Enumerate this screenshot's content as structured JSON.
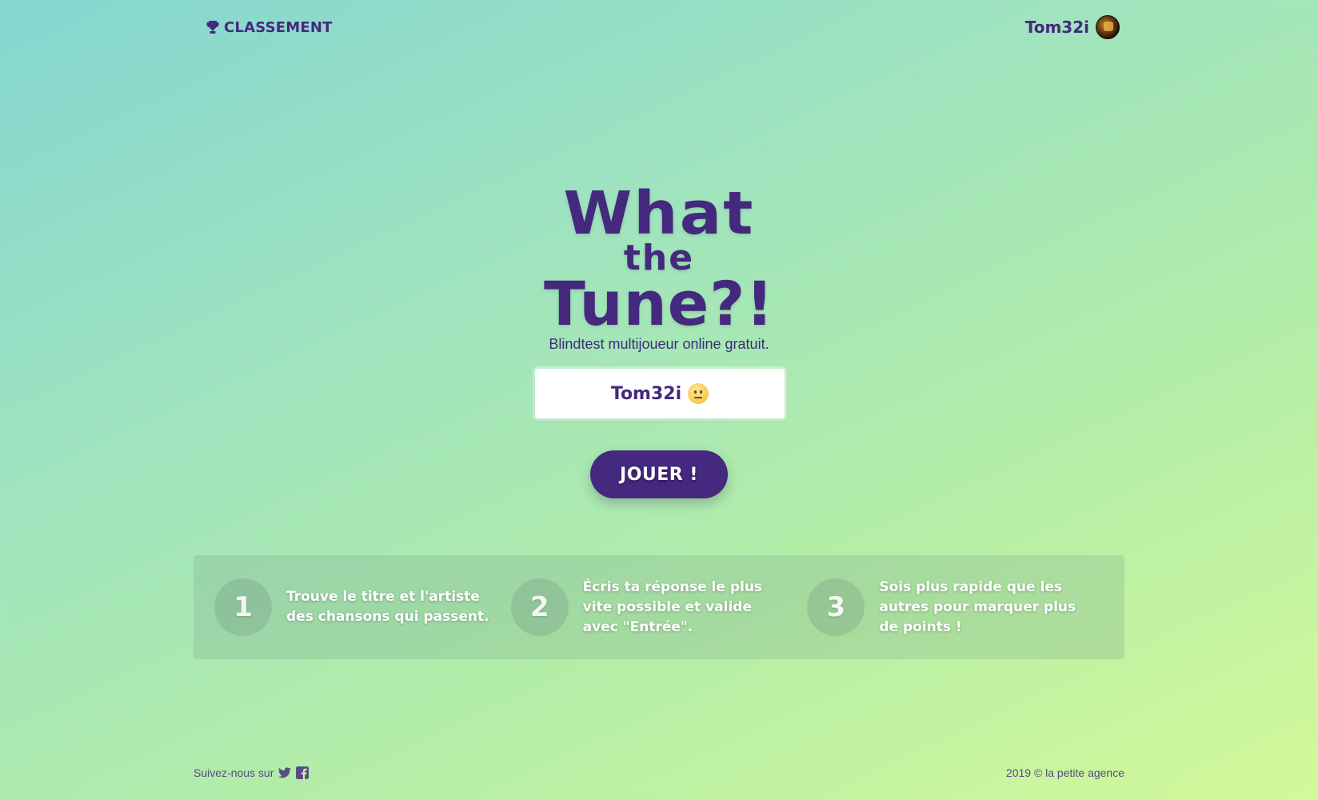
{
  "header": {
    "ranking_label": "CLASSEMENT",
    "user_name": "Tom32i"
  },
  "hero": {
    "logo_line1": "What",
    "logo_line2": "the",
    "logo_line3": "Tune?!",
    "tagline": "Blindtest multijoueur online gratuit."
  },
  "player": {
    "name": "Tom32i",
    "emoji": "confused-face"
  },
  "play_button": "JOUER !",
  "steps": [
    {
      "number": "1",
      "text": "Trouve le titre et l'artiste des chansons qui passent."
    },
    {
      "number": "2",
      "text": "Écris ta réponse le plus vite possible et valide avec \"Entrée\"."
    },
    {
      "number": "3",
      "text": "Sois plus rapide que les autres pour marquer plus de points !"
    }
  ],
  "footer": {
    "follow_label": "Suivez-nous sur",
    "copyright": "2019 © la petite agence"
  },
  "colors": {
    "brand": "#44297e",
    "gradient_start": "#84d6d0",
    "gradient_end": "#d3f99a"
  }
}
